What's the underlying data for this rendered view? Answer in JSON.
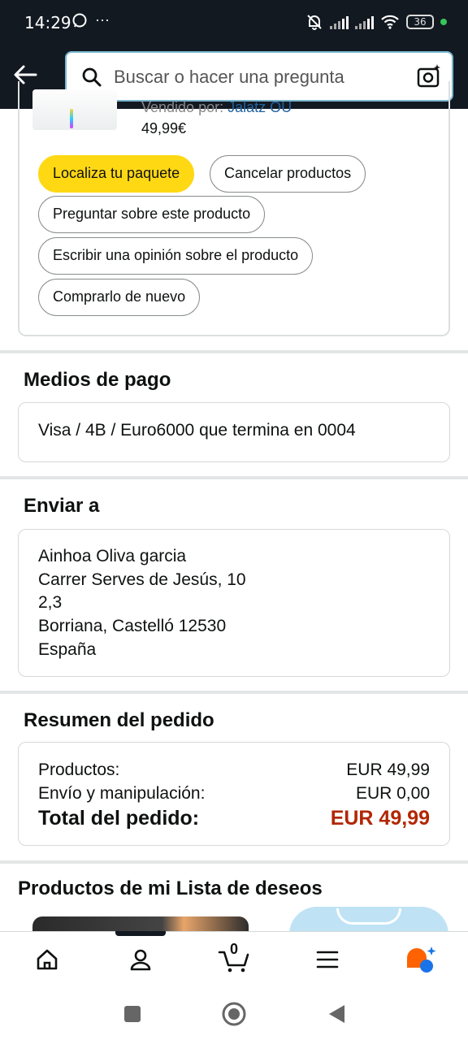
{
  "status_bar": {
    "time": "14:29",
    "extra": "···",
    "battery": "36"
  },
  "search": {
    "placeholder": "Buscar o hacer una pregunta"
  },
  "product": {
    "seller_prefix": "Vendido por:",
    "seller_name": "Jalatz OU",
    "price": "49,99€"
  },
  "actions": {
    "track": "Localiza tu paquete",
    "cancel": "Cancelar productos",
    "ask": "Preguntar sobre este producto",
    "review": "Escribir una opinión sobre el producto",
    "rebuy": "Comprarlo de nuevo"
  },
  "payment": {
    "title": "Medios de pago",
    "method": "Visa / 4B / Euro6000  que termina en 0004"
  },
  "shipping": {
    "title": "Enviar a",
    "lines": [
      "Ainhoa Oliva garcia",
      "Carrer Serves de Jesús, 10",
      "2,3",
      "Borriana, Castelló 12530",
      "España"
    ]
  },
  "summary": {
    "title": "Resumen del pedido",
    "products_label": "Productos:",
    "products_value": "EUR 49,99",
    "shipping_label": "Envío y manipulación:",
    "shipping_value": "EUR 0,00",
    "total_label": "Total del pedido:",
    "total_value": "EUR 49,99",
    "total_color": "#b12704"
  },
  "wishlist": {
    "title": "Productos de mi Lista de deseos"
  },
  "bottom_nav": {
    "cart_count": "0"
  },
  "colors": {
    "header_bg": "#131921",
    "primary_button": "#ffd814",
    "link": "#2162a1"
  }
}
